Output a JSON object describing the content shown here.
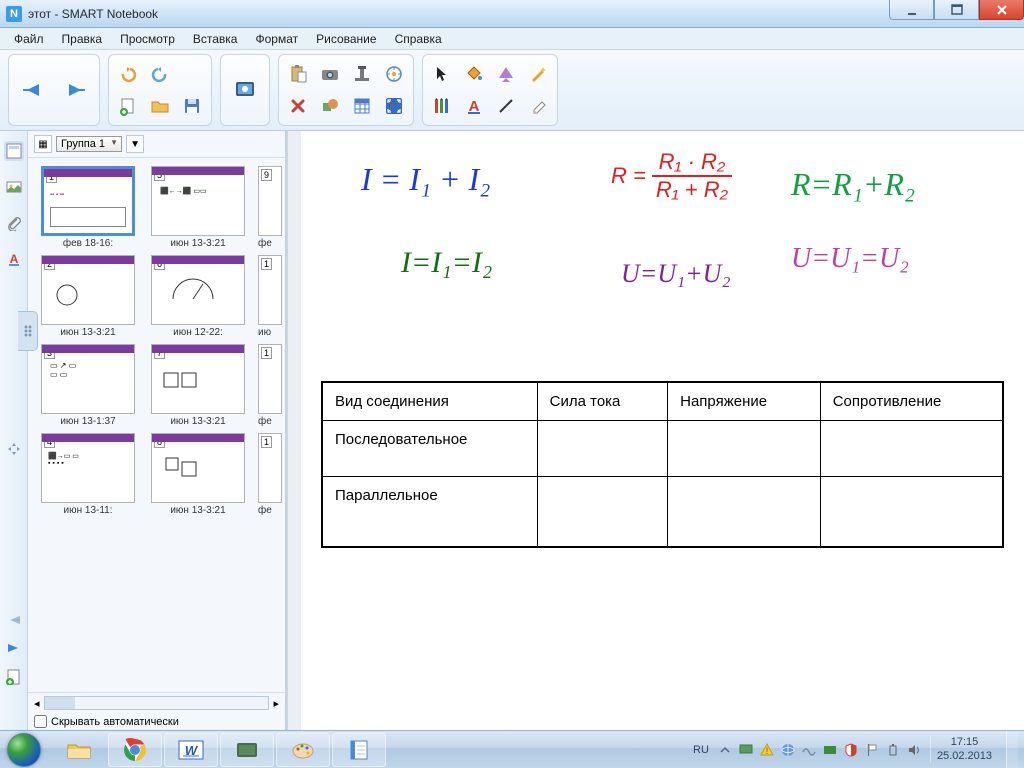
{
  "title": "этот - SMART Notebook",
  "menu": [
    "Файл",
    "Правка",
    "Просмотр",
    "Вставка",
    "Формат",
    "Рисование",
    "Справка"
  ],
  "sidepanel": {
    "group": "Группа 1",
    "hideAuto": "Скрывать автоматически",
    "thumbs": [
      {
        "n": "1",
        "label": "фев  18-16:"
      },
      {
        "n": "5",
        "label": "июн 13-3:21"
      },
      {
        "n": "9",
        "label": "фе"
      },
      {
        "n": "2",
        "label": "июн 13-3:21"
      },
      {
        "n": "6",
        "label": "июн  12-22:"
      },
      {
        "n": "1",
        "label": "ию"
      },
      {
        "n": "3",
        "label": "июн 13-1:37"
      },
      {
        "n": "7",
        "label": "июн 13-3:21"
      },
      {
        "n": "1",
        "label": "фе"
      },
      {
        "n": "4",
        "label": "июн  13-11:"
      },
      {
        "n": "8",
        "label": "июн 13-3:21"
      },
      {
        "n": "1",
        "label": "фе"
      }
    ]
  },
  "formulas": {
    "f1": "I  =   I₁  +   I₂",
    "f2_lhs": "R =",
    "f2_num": "R₁ · R₂",
    "f2_den": "R₁ + R₂",
    "f3": "R=R₁+R₂",
    "f4": "I=I₁=I₂",
    "f5": "U=U₁+U₂",
    "f6": "U=U₁=U₂"
  },
  "table": {
    "headers": [
      "Вид соединения",
      "Сила тока",
      "Напряжение",
      "Сопротивление"
    ],
    "rows": [
      "Последовательное",
      "Параллельное"
    ]
  },
  "taskbar": {
    "lang": "RU",
    "time": "17:15",
    "date": "25.02.2013"
  }
}
